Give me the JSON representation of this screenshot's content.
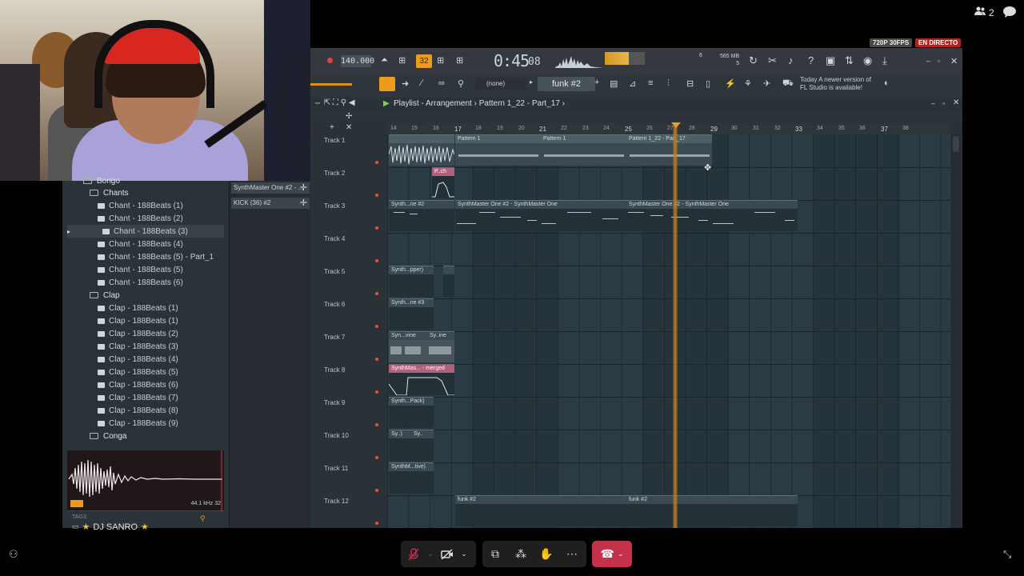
{
  "call": {
    "participant_count": "2",
    "quality_badge": "720P 30FPS",
    "live_badge": "EN DIRECTO",
    "presenter_name": "DJ SANRO"
  },
  "browser": {
    "items": [
      {
        "label": "Bongo",
        "type": "folder"
      },
      {
        "label": "Chants",
        "type": "folder"
      },
      {
        "label": "Chant - 188Beats (1)",
        "type": "file"
      },
      {
        "label": "Chant - 188Beats (2)",
        "type": "file"
      },
      {
        "label": "Chant - 188Beats (3)",
        "type": "file",
        "selected": true
      },
      {
        "label": "Chant - 188Beats (4)",
        "type": "file"
      },
      {
        "label": "Chant - 188Beats (5) - Part_1",
        "type": "file"
      },
      {
        "label": "Chant - 188Beats (5)",
        "type": "file"
      },
      {
        "label": "Chant - 188Beats (6)",
        "type": "file"
      },
      {
        "label": "Clap",
        "type": "folder"
      },
      {
        "label": "Clap - 188Beats (1)",
        "type": "file"
      },
      {
        "label": "Clap - 188Beats (1)",
        "type": "file"
      },
      {
        "label": "Clap - 188Beats (2)",
        "type": "file"
      },
      {
        "label": "Clap - 188Beats (3)",
        "type": "file"
      },
      {
        "label": "Clap - 188Beats (4)",
        "type": "file"
      },
      {
        "label": "Clap - 188Beats (5)",
        "type": "file"
      },
      {
        "label": "Clap - 188Beats (6)",
        "type": "file"
      },
      {
        "label": "Clap - 188Beats (7)",
        "type": "file"
      },
      {
        "label": "Clap - 188Beats (8)",
        "type": "file"
      },
      {
        "label": "Clap - 188Beats (9)",
        "type": "file"
      },
      {
        "label": "Conga",
        "type": "folder"
      }
    ],
    "tags_label": "TAGS",
    "sample_rate": "44.1 kHz 32"
  },
  "channels": [
    {
      "label": "SynthMaster One #2 - ..."
    },
    {
      "label": "KICK (36) #2"
    }
  ],
  "transport": {
    "tempo": "140.000",
    "time_main": "0:45",
    "time_sub": "08",
    "pattern_step": "32",
    "mem": "565 MB",
    "mem_sub": "5",
    "cpu": "6",
    "none_selector": "(none)",
    "pattern": "funk #2",
    "news_line1": "Today  A newer version of",
    "news_line2": "FL Studio is available!"
  },
  "playlist": {
    "title": "Playlist - Arrangement",
    "breadcrumb": "Pattern 1_22 - Part_17",
    "ruler": [
      "14",
      "15",
      "16",
      "17",
      "18",
      "19",
      "20",
      "21",
      "22",
      "23",
      "24",
      "25",
      "26",
      "27",
      "28",
      "29",
      "30",
      "31",
      "32",
      "33",
      "34",
      "35",
      "36",
      "37",
      "38"
    ],
    "tracks": [
      "Track 1",
      "Track 2",
      "Track 3",
      "Track 4",
      "Track 5",
      "Track 6",
      "Track 7",
      "Track 8",
      "Track 9",
      "Track 10",
      "Track 11",
      "Track 12"
    ],
    "clips": {
      "t1_a": "",
      "t1_b": "Pattern 1",
      "t1_c": "Pattern 1",
      "t1_d": "Pattern 1_22 - Part_17",
      "t2_a": "P..ch",
      "t3_a": "Synth...ne #2",
      "t3_b": "SynthMaster One #2 - SynthMaster One",
      "t3_c": "SynthMaster One #2 - SynthMaster One",
      "t5_a": "Synth...pper)",
      "t6_a": "Synth...ne #3",
      "t7_a": "Syn...vine",
      "t7_b": "Sy..ine",
      "t8_a": "SynthMas... - merged",
      "t9_a": "Synth...Pack)",
      "t10_a": "Sy..)",
      "t10_b": "Sy..",
      "t11_a": "SynthM...tive)",
      "t12_a": "funk #2",
      "t12_b": "funk #2"
    }
  },
  "colors": {
    "accent": "#f09a1c",
    "hangup": "#c4314b",
    "live": "#b7211d"
  }
}
